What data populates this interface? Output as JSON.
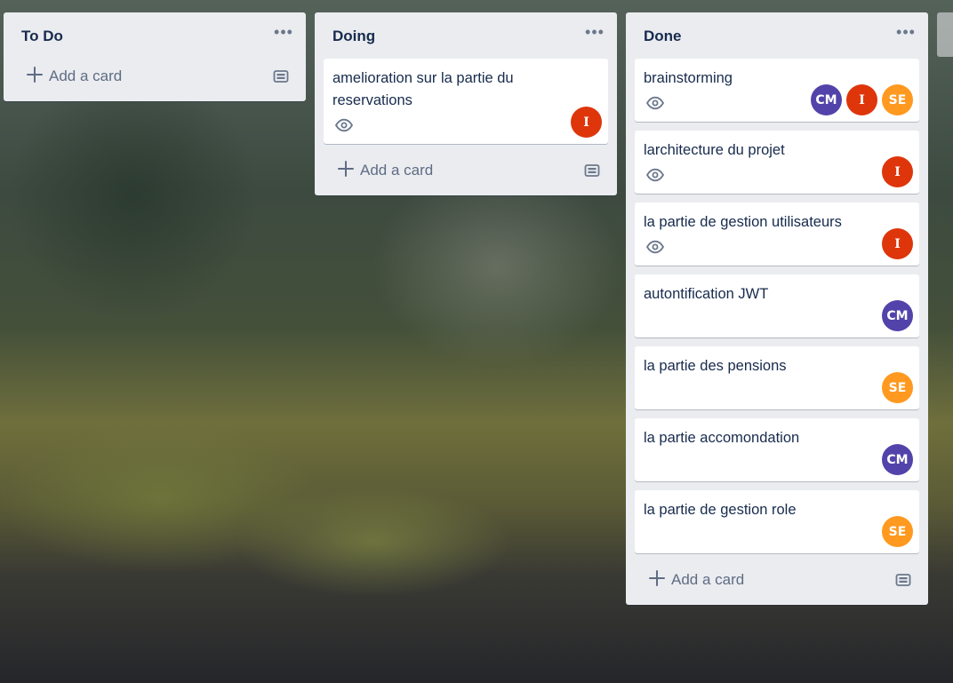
{
  "colors": {
    "list_bg": "#ebecf0",
    "card_bg": "#ffffff",
    "title_text": "#172b4d",
    "muted_text": "#5e6c84",
    "avatar_cm": "#5243aa",
    "avatar_i": "#de350b",
    "avatar_se": "#ff991f"
  },
  "lists": [
    {
      "title": "To Do",
      "menu_icon": "ellipsis-icon",
      "add_card_label": "Add a card",
      "cards": []
    },
    {
      "title": "Doing",
      "menu_icon": "ellipsis-icon",
      "add_card_label": "Add a card",
      "cards": [
        {
          "title": "amelioration sur la partie du reservations",
          "watched": true,
          "members": [
            "I"
          ]
        }
      ]
    },
    {
      "title": "Done",
      "menu_icon": "ellipsis-icon",
      "add_card_label": "Add a card",
      "cards": [
        {
          "title": "brainstorming",
          "watched": true,
          "members": [
            "CM",
            "I",
            "SE"
          ]
        },
        {
          "title": "larchitecture du projet",
          "watched": true,
          "members": [
            "I"
          ]
        },
        {
          "title": "la partie de gestion utilisateurs",
          "watched": true,
          "members": [
            "I"
          ]
        },
        {
          "title": "autontification JWT",
          "watched": false,
          "members": [
            "CM"
          ]
        },
        {
          "title": "la partie des pensions",
          "watched": false,
          "members": [
            "SE"
          ]
        },
        {
          "title": "la partie accomondation",
          "watched": false,
          "members": [
            "CM"
          ]
        },
        {
          "title": "la partie de gestion role",
          "watched": false,
          "members": [
            "SE"
          ]
        }
      ]
    }
  ]
}
